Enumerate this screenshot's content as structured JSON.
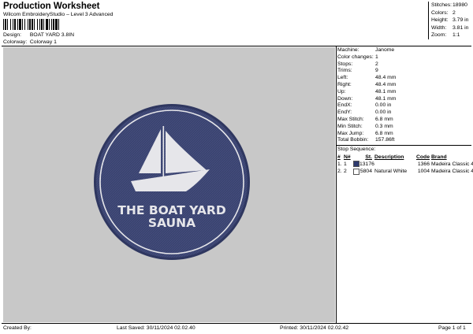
{
  "header": {
    "title": "Production Worksheet",
    "software": "Wilcom EmbroideryStudio – Level 3 Advanced",
    "design_label": "Design:",
    "design_value": "BOAT YARD 3.8IN",
    "colorway_label": "Colorway:",
    "colorway_value": "Colorway 1"
  },
  "top_stats": [
    {
      "label": "Stitches:",
      "value": "18980"
    },
    {
      "label": "Colors:",
      "value": "2"
    },
    {
      "label": "Height:",
      "value": "3.79 in"
    },
    {
      "label": "Width:",
      "value": "3.81 in"
    },
    {
      "label": "Zoom:",
      "value": "1:1"
    }
  ],
  "design": {
    "patch_line1": "THE BOAT YARD",
    "patch_line2": "SAUNA",
    "colors": {
      "canvas": "#c8c8c8",
      "navy": "#3a4370",
      "thread_white": "#e6e6ea"
    }
  },
  "machine_info": [
    {
      "label": "Machine:",
      "value": "Janome"
    },
    {
      "label": "Color changes:",
      "value": "1"
    },
    {
      "label": "Stops:",
      "value": "2"
    },
    {
      "label": "Trims:",
      "value": "9"
    },
    {
      "label": "Left:",
      "value": "48.4 mm"
    },
    {
      "label": "Right:",
      "value": "48.4 mm"
    },
    {
      "label": "Up:",
      "value": "48.1 mm"
    },
    {
      "label": "Down:",
      "value": "48.1 mm"
    },
    {
      "label": "EndX:",
      "value": "0.00 in"
    },
    {
      "label": "EndY:",
      "value": "0.00 in"
    },
    {
      "label": "Max Stitch:",
      "value": "6.8 mm"
    },
    {
      "label": "Min Stitch:",
      "value": "0.3 mm"
    },
    {
      "label": "Max Jump:",
      "value": "6.8 mm"
    },
    {
      "label": "Total Bobbin:",
      "value": "157.86ft"
    }
  ],
  "stop_sequence": {
    "title": "Stop Sequence:",
    "headers": [
      "#",
      "N#",
      "St.",
      "Description",
      "Code",
      "Brand"
    ],
    "rows": [
      {
        "num": "1.",
        "n": "1",
        "swatch": "#2d3a6e",
        "st": "13176",
        "desc": "",
        "code": "1366",
        "brand": "Madeira Classic 40"
      },
      {
        "num": "2.",
        "n": "2",
        "swatch": "#ffffff",
        "st": "5804",
        "desc": "Natural White",
        "code": "1004",
        "brand": "Madeira Classic 40"
      }
    ]
  },
  "footer": {
    "created": "Created By:",
    "saved": "Last Saved: 30/11/2024 02.02.40",
    "printed": "Printed: 30/11/2024 02.02.42",
    "page": "Page 1 of 1"
  }
}
